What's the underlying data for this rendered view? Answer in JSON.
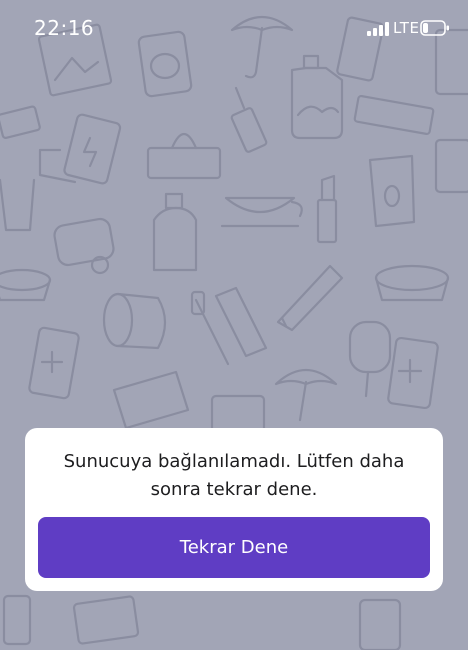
{
  "status_bar": {
    "time": "22:16",
    "carrier": "LTE",
    "signal_icon": "cellular-signal-icon",
    "battery_icon": "battery-low-icon",
    "battery_level": 0.25
  },
  "background": {
    "color": "#a2a5b6",
    "pattern_color": "#8a8da0",
    "pattern": "household-items-doodle-pattern"
  },
  "dialog": {
    "message": "Sunucuya bağlanılamadı. Lütfen daha sonra tekrar dene.",
    "retry_label": "Tekrar Dene",
    "accent_color": "#5f3dc4"
  }
}
